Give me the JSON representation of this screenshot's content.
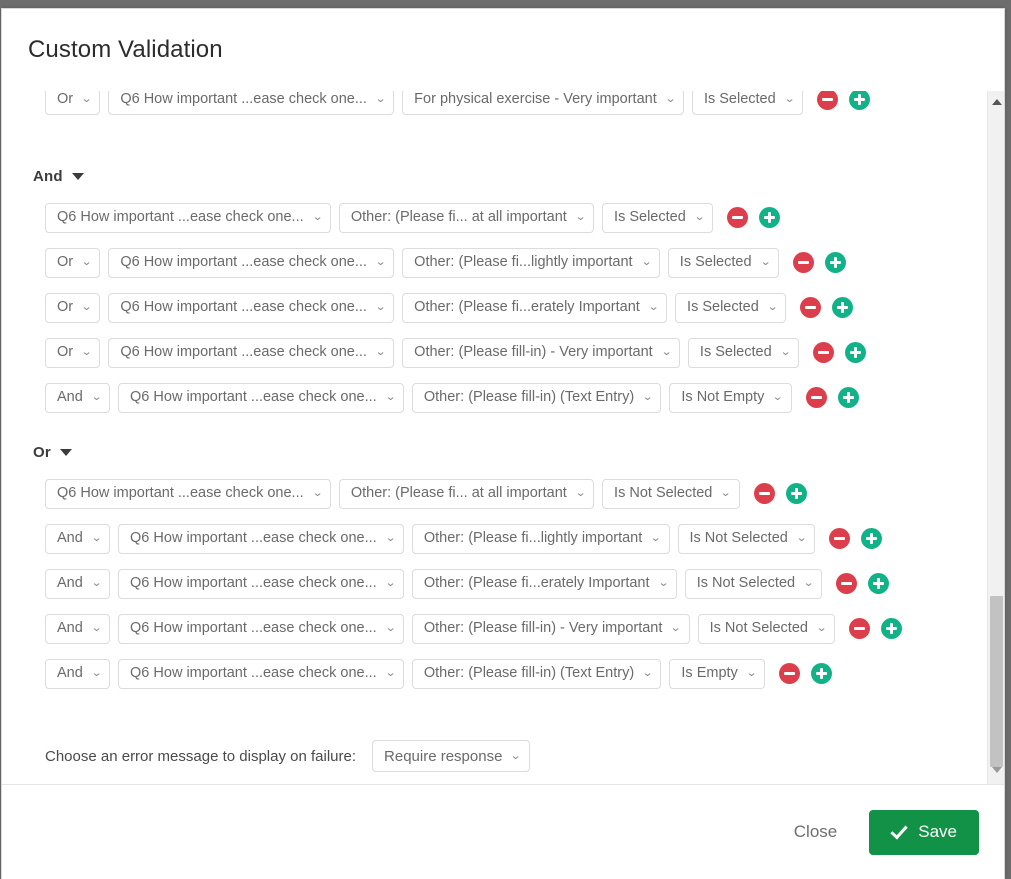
{
  "modal": {
    "title": "Custom Validation",
    "footer": {
      "close_label": "Close",
      "save_label": "Save",
      "save_icon": "check-icon"
    }
  },
  "colors": {
    "save_button": "#119247",
    "remove_icon": "#dc3f4b",
    "add_icon": "#12b289",
    "select_border": "#dcdcdc",
    "select_text": "#6a6a6a"
  },
  "icons": {
    "remove": "minus-circle-icon",
    "add": "plus-circle-icon",
    "chevron": "chevron-down-icon",
    "caret": "caret-down-icon",
    "scroll_up": "scroll-up-arrow-icon",
    "scroll_down": "scroll-down-arrow-icon"
  },
  "chevron_glyph": "⌄",
  "groups": [
    {
      "header": null,
      "rows": [
        {
          "conjunction": "Or",
          "question": "Q6 How important ...ease check one...",
          "choice": "For physical exercise - Very important",
          "operator": "Is Selected"
        }
      ]
    },
    {
      "header": "And",
      "rows": [
        {
          "conjunction": null,
          "question": "Q6 How important ...ease check one...",
          "choice": "Other: (Please fi... at all important",
          "operator": "Is Selected"
        },
        {
          "conjunction": "Or",
          "question": "Q6 How important ...ease check one...",
          "choice": "Other: (Please fi...lightly important",
          "operator": "Is Selected"
        },
        {
          "conjunction": "Or",
          "question": "Q6 How important ...ease check one...",
          "choice": "Other: (Please fi...erately Important",
          "operator": "Is Selected"
        },
        {
          "conjunction": "Or",
          "question": "Q6 How important ...ease check one...",
          "choice": "Other: (Please fill-in) - Very important",
          "operator": "Is Selected"
        },
        {
          "conjunction": "And",
          "question": "Q6 How important ...ease check one...",
          "choice": "Other: (Please fill-in) (Text Entry)",
          "operator": "Is Not Empty"
        }
      ]
    },
    {
      "header": "Or",
      "rows": [
        {
          "conjunction": null,
          "question": "Q6 How important ...ease check one...",
          "choice": "Other: (Please fi... at all important",
          "operator": "Is Not Selected"
        },
        {
          "conjunction": "And",
          "question": "Q6 How important ...ease check one...",
          "choice": "Other: (Please fi...lightly important",
          "operator": "Is Not Selected"
        },
        {
          "conjunction": "And",
          "question": "Q6 How important ...ease check one...",
          "choice": "Other: (Please fi...erately Important",
          "operator": "Is Not Selected"
        },
        {
          "conjunction": "And",
          "question": "Q6 How important ...ease check one...",
          "choice": "Other: (Please fill-in) - Very important",
          "operator": "Is Not Selected"
        },
        {
          "conjunction": "And",
          "question": "Q6 How important ...ease check one...",
          "choice": "Other: (Please fill-in) (Text Entry)",
          "operator": "Is Empty"
        }
      ]
    }
  ],
  "error_message": {
    "label": "Choose an error message to display on failure:",
    "selected": "Require response"
  }
}
